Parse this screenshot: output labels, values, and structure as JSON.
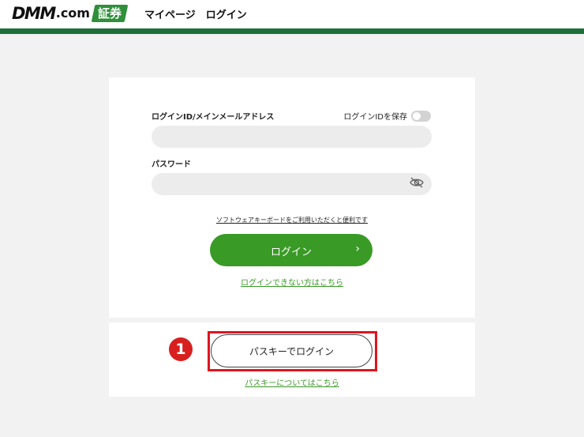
{
  "header": {
    "logo_text": "DMM",
    "logo_suffix": ".com",
    "logo_badge": "証券",
    "nav": {
      "mypage": "マイページ",
      "login": "ログイン"
    },
    "accent_color": "#1f6e3a"
  },
  "login_form": {
    "id_label": "ログインID/メインメールアドレス",
    "save_id_label": "ログインIDを保存",
    "save_id_enabled": false,
    "id_value": "",
    "password_label": "パスワード",
    "password_value": "",
    "password_toggle_icon": "eye-slash-icon",
    "software_keyboard_link": "ソフトウェアキーボードをご利用いただくと便利です",
    "login_button": "ログイン",
    "login_button_arrow": "›",
    "cant_login_link": "ログインできない方はこちら",
    "button_color": "#3a9a26"
  },
  "passkey": {
    "step_marker": "1",
    "button": "パスキーでログイン",
    "about_link": "パスキーについてはこちら",
    "highlight_color": "#e0141e"
  }
}
